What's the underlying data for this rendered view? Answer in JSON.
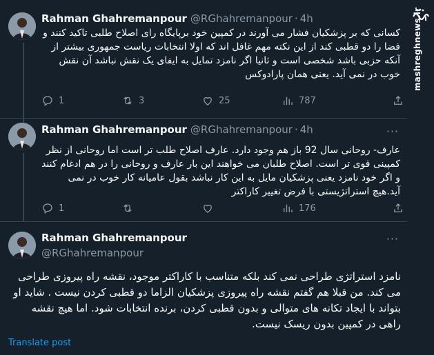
{
  "tweets": [
    {
      "name": "Rahman Ghahremanpour",
      "handle": "@RGhahremanpour",
      "dot": "·",
      "time": "4h",
      "text": "کسانی که بر پزشکیان فشار می آورند در کمپین خود برپایگاه رای اصلاح طلبی تاکید کنند و فضا را دو قطبی کند از این نکته مهم غافل اند که اولا انتخابات ریاست جمهوری بیشتر از آنکه حزبی باشد شخصی است و ثانیا اگر نامزد تمایل به ایفای یک نقش نباشد آن نقش خوب در نمی آید. یعنی همان پارادوکس",
      "replies": "1",
      "retweets": "3",
      "likes": "25",
      "views": "787"
    },
    {
      "name": "Rahman Ghahremanpour",
      "handle": "@RGhahremanpour",
      "dot": "·",
      "time": "4h",
      "text": "عارف- روحانی سال 92 باز هم وجود دارد. عارف اصلاح طلب تر است اما روحانی از نظر کمپینی قوی تر است. اصلاح طلبان می خواهند این بار عارف و روحانی را در هم ادغام کنند و اگر خود نامزد یعنی پزشکیان مایل به این کار نباشد بقول عامیانه کار خوب در نمی آید.هیچ استراتژیستی با فرض تغییر کاراکتر",
      "replies": "1",
      "retweets": "",
      "likes": "",
      "views": "176"
    },
    {
      "name": "Rahman Ghahremanpour",
      "handle": "@RGhahremanpour",
      "text": "نامزد استراتژی طراحی نمی کند بلکه متناسب با کاراکتر موجود، نقشه راه پیروزی طراحی می کند. من قبلا هم گفتم نقشه راه پیروزی پزشکیان الزاما دو قطبی کردن نیست . شاید او بتواند با ایجاد تکانه های متوالی و بدون قطبی کردن، برنده انتخابات شود. اما هیچ نقشه راهی در کمپین بدون ریسک نیست.",
      "translate": "Translate post"
    }
  ],
  "watermark": {
    "site": "mashreghnews.ir",
    "logo_text": "مشرق"
  },
  "colors": {
    "background": "#15202b",
    "text": "#f7f9f9",
    "muted": "#8b98a5",
    "accent": "#1d9bf0",
    "divider": "#38444d"
  },
  "icons": [
    "reply-icon",
    "retweet-icon",
    "like-icon",
    "views-icon",
    "share-icon",
    "more-icon"
  ]
}
